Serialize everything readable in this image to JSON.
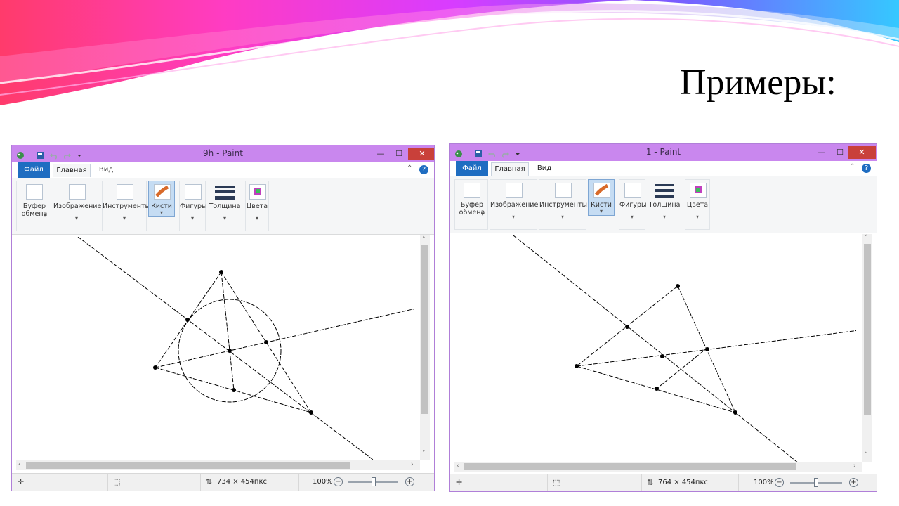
{
  "slide": {
    "title": "Примеры:"
  },
  "windows": [
    {
      "title": "9h - Paint",
      "tabs": {
        "file": "Файл",
        "home": "Главная",
        "view": "Вид"
      },
      "ribbon": [
        {
          "label": "Буфер обмена",
          "icon": "clipboard-icon"
        },
        {
          "label": "Изображение",
          "icon": "select-icon"
        },
        {
          "label": "Инструменты",
          "icon": "tools-icon"
        },
        {
          "label": "Кисти",
          "icon": "brush-icon",
          "selected": true
        },
        {
          "label": "Фигуры",
          "icon": "shapes-icon"
        },
        {
          "label": "Толщина",
          "icon": "thickness-icon"
        },
        {
          "label": "Цвета",
          "icon": "colors-icon"
        }
      ],
      "status": {
        "size": "734 × 454пкс",
        "zoom": "100%"
      },
      "drawing": "triangle with incircle, angle bisectors and points"
    },
    {
      "title": "1 - Paint",
      "tabs": {
        "file": "Файл",
        "home": "Главная",
        "view": "Вид"
      },
      "ribbon": [
        {
          "label": "Буфер обмена",
          "icon": "clipboard-icon"
        },
        {
          "label": "Изображение",
          "icon": "select-icon"
        },
        {
          "label": "Инструменты",
          "icon": "tools-icon"
        },
        {
          "label": "Кисти",
          "icon": "brush-icon",
          "selected": true
        },
        {
          "label": "Фигуры",
          "icon": "shapes-icon"
        },
        {
          "label": "Толщина",
          "icon": "thickness-icon"
        },
        {
          "label": "Цвета",
          "icon": "colors-icon"
        }
      ],
      "status": {
        "size": "764 × 454пкс",
        "zoom": "100%"
      },
      "drawing": "triangle with cevians intersecting at a point"
    }
  ],
  "colors": {
    "titlebar": "#c987ee",
    "file_tab": "#1f6dc1",
    "close": "#c9403a",
    "banner": [
      "#ff3b6b",
      "#ff45d8",
      "#c43bff",
      "#35c8ff"
    ]
  }
}
